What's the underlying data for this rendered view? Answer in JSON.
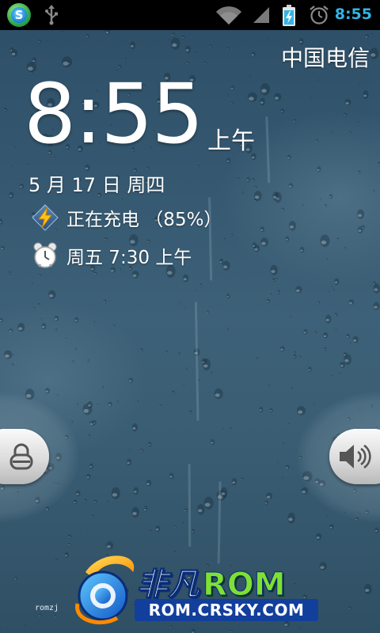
{
  "status_bar": {
    "time": "8:55",
    "icons": [
      "app-notification-icon",
      "usb-icon",
      "wifi-icon",
      "signal-icon",
      "battery-charging-icon",
      "alarm-icon"
    ]
  },
  "lockscreen": {
    "carrier": "中国电信",
    "clock": "8:55",
    "ampm": "上午",
    "date": "5 月 17 日 周四",
    "charging": "正在充电 （85%）",
    "alarm": "周五 7:30 上午",
    "icons": {
      "charging": "lightning-bolt-icon",
      "alarm": "alarm-clock-icon",
      "unlock": "lock-icon",
      "sound": "speaker-icon"
    }
  },
  "watermark": {
    "tag": "romzj",
    "brand_cn": "非凡",
    "brand_en": "ROM",
    "url": "ROM.CRSKY.COM"
  },
  "colors": {
    "status_time": "#33b5e5",
    "text": "#ffffff",
    "background_top": "#2d4e66",
    "background_mid": "#3d6178"
  }
}
